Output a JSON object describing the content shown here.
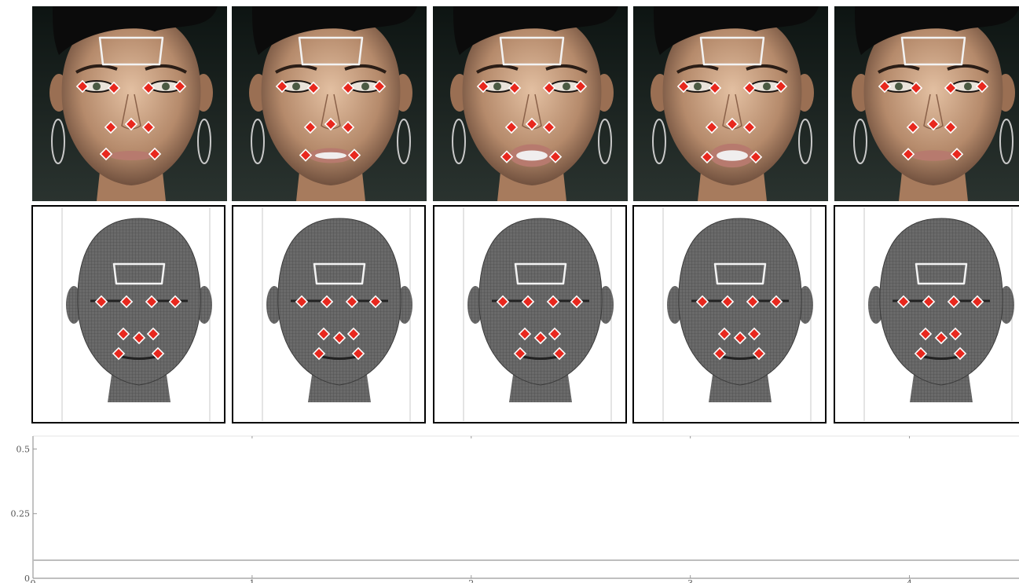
{
  "colors": {
    "photo_bg": "#1b2320",
    "skin": "#c9a083",
    "mesh": "#666666",
    "mesh_line": "#3c3c3c",
    "landmark_fill": "#e8281e",
    "landmark_outline": "#ffffff",
    "panel_border": "#000000",
    "axis": "#9a9a9a",
    "signal": "#bdbdbd"
  },
  "frames": [
    {
      "photo_mouth": "closed",
      "mouth_open": 0.0
    },
    {
      "photo_mouth": "slightly-open",
      "mouth_open": 0.25
    },
    {
      "photo_mouth": "open",
      "mouth_open": 0.6
    },
    {
      "photo_mouth": "open",
      "mouth_open": 0.65
    },
    {
      "photo_mouth": "closed",
      "mouth_open": 0.05
    }
  ],
  "icons": {
    "landmark": "red-diamond-marker",
    "forehead_region": "white-rounded-rectangle-outline"
  },
  "chart_data": {
    "type": "line",
    "ylim": [
      0,
      0.55
    ],
    "xlim": [
      0,
      4.5
    ],
    "yticks": [
      "0",
      "0.25",
      "0.5"
    ],
    "xticks": [
      "0",
      "1",
      "2",
      "3",
      "4"
    ],
    "xlabel": "",
    "series": [
      {
        "x": [
          0,
          4.5
        ],
        "y": [
          0.07,
          0.07
        ]
      }
    ]
  }
}
